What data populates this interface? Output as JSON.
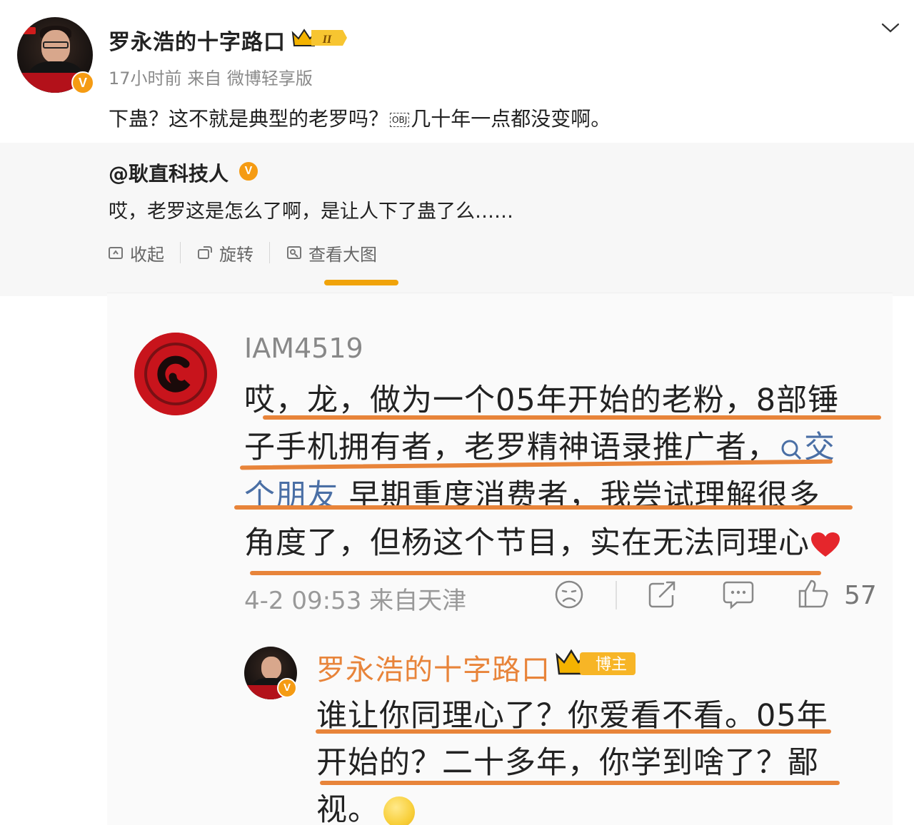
{
  "post": {
    "author": "罗永浩的十字路口",
    "vip_level": "II",
    "time": "17小时前",
    "source": "来自 微博轻享版",
    "text_before": "下蛊？这不就是典型的老罗吗？",
    "obj_glyph": "OBJ",
    "text_after": "几十年一点都没变啊。"
  },
  "repost": {
    "author": "@耿直科技人",
    "text": "哎，老罗这是怎么了啊，是让人下了蛊了么……",
    "toolbar": {
      "collapse_label": "收起",
      "rotate_label": "旋转",
      "view_large_label": "查看大图"
    }
  },
  "comment": {
    "username": "IAM4519",
    "lines": [
      "哎，龙，做为一个05年开始的老粉，8部锤",
      "子手机拥有者，老罗精神语录推广者，",
      "早期重度消费者，我尝试理解很多",
      "角度了，但杨这个节目，实在无法同理心"
    ],
    "link_part1": "交",
    "link_part2": "个朋友",
    "time": "4-2 09:53",
    "location": "来自天津",
    "like_count": "57"
  },
  "reply": {
    "username": "罗永浩的十字路口",
    "badge": "博主",
    "lines": [
      "谁让你同理心了？你爱看不看。05年",
      "开始的？二十多年，你学到啥了？鄙",
      "视。"
    ]
  },
  "colors": {
    "accent_orange": "#e8843a",
    "link_blue": "#4a6fa5",
    "verified_orange": "#f59b13",
    "tab_indicator": "#f0a30a"
  }
}
